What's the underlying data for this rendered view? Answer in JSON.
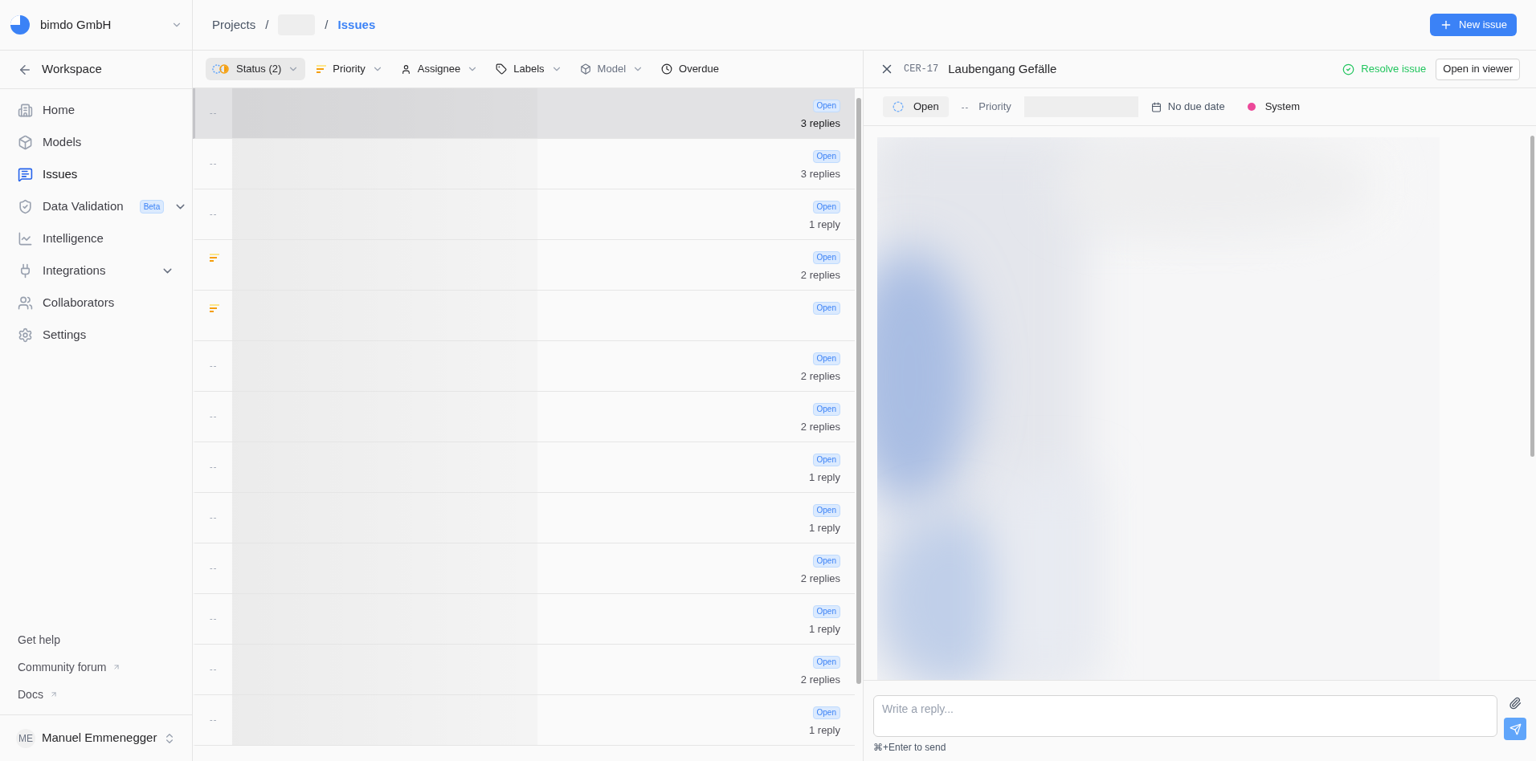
{
  "sidebar": {
    "org": "bimdo GmbH",
    "back": "Workspace",
    "items": [
      {
        "label": "Home",
        "selected": false,
        "expandable": false
      },
      {
        "label": "Models",
        "selected": false,
        "expandable": false
      },
      {
        "label": "Issues",
        "selected": true,
        "expandable": false
      },
      {
        "label": "Data Validation",
        "selected": false,
        "badge": "Beta",
        "expandable": true
      },
      {
        "label": "Intelligence",
        "selected": false,
        "expandable": false
      },
      {
        "label": "Integrations",
        "selected": false,
        "expandable": true
      },
      {
        "label": "Collaborators",
        "selected": false,
        "expandable": false
      },
      {
        "label": "Settings",
        "selected": false,
        "expandable": false
      }
    ],
    "links": [
      {
        "label": "Get help",
        "external": false
      },
      {
        "label": "Community forum",
        "external": true
      },
      {
        "label": "Docs",
        "external": true
      }
    ],
    "user": {
      "initials": "ME",
      "name": "Manuel Emmenegger"
    }
  },
  "breadcrumb": [
    {
      "kind": "link",
      "label": "Projects"
    },
    {
      "kind": "separator",
      "label": "/"
    },
    {
      "kind": "redacted"
    },
    {
      "kind": "separator",
      "label": "/"
    },
    {
      "kind": "current",
      "label": "Issues"
    }
  ],
  "new_issue": "New issue",
  "filters": [
    {
      "label": "Status (2)",
      "selected": true,
      "dropdown": true,
      "disabled": false
    },
    {
      "label": "Priority",
      "selected": false,
      "dropdown": true,
      "disabled": false
    },
    {
      "label": "Assignee",
      "selected": false,
      "dropdown": true,
      "disabled": false
    },
    {
      "label": "Labels",
      "selected": false,
      "dropdown": true,
      "disabled": false
    },
    {
      "label": "Model",
      "selected": false,
      "dropdown": true,
      "disabled": true
    },
    {
      "label": "Overdue",
      "selected": false,
      "dropdown": false,
      "disabled": false
    }
  ],
  "issues": [
    {
      "priority": {
        "kind": "none",
        "text": "--"
      },
      "status": "Open",
      "replies": "3 replies",
      "selected": true
    },
    {
      "priority": {
        "kind": "none",
        "text": "--"
      },
      "status": "Open",
      "replies": "3 replies",
      "selected": false
    },
    {
      "priority": {
        "kind": "none",
        "text": "--"
      },
      "status": "Open",
      "replies": "1 reply",
      "selected": false
    },
    {
      "priority": {
        "kind": "medium"
      },
      "status": "Open",
      "replies": "2 replies",
      "selected": false
    },
    {
      "priority": {
        "kind": "medium"
      },
      "status": "Open",
      "selected": false
    },
    {
      "priority": {
        "kind": "none",
        "text": "--"
      },
      "status": "Open",
      "replies": "2 replies",
      "selected": false
    },
    {
      "priority": {
        "kind": "none",
        "text": "--"
      },
      "status": "Open",
      "replies": "2 replies",
      "selected": false
    },
    {
      "priority": {
        "kind": "none",
        "text": "--"
      },
      "status": "Open",
      "replies": "1 reply",
      "selected": false
    },
    {
      "priority": {
        "kind": "none",
        "text": "--"
      },
      "status": "Open",
      "replies": "1 reply",
      "selected": false
    },
    {
      "priority": {
        "kind": "none",
        "text": "--"
      },
      "status": "Open",
      "replies": "2 replies",
      "selected": false
    },
    {
      "priority": {
        "kind": "none",
        "text": "--"
      },
      "status": "Open",
      "replies": "1 reply",
      "selected": false
    },
    {
      "priority": {
        "kind": "none",
        "text": "--"
      },
      "status": "Open",
      "replies": "2 replies",
      "selected": false
    },
    {
      "priority": {
        "kind": "none",
        "text": "--"
      },
      "status": "Open",
      "replies": "1 reply",
      "selected": false
    }
  ],
  "detail": {
    "key": "CER-17",
    "title": "Laubengang Gefälle",
    "resolve": "Resolve issue",
    "open_viewer": "Open in viewer",
    "status": "Open",
    "priority_placeholder": "--",
    "priority_label": "Priority",
    "due": "No due date",
    "label": {
      "text": "System",
      "color": "#ec4899"
    },
    "reply": {
      "placeholder": "Write a reply...",
      "hint": "⌘+Enter to send"
    }
  }
}
